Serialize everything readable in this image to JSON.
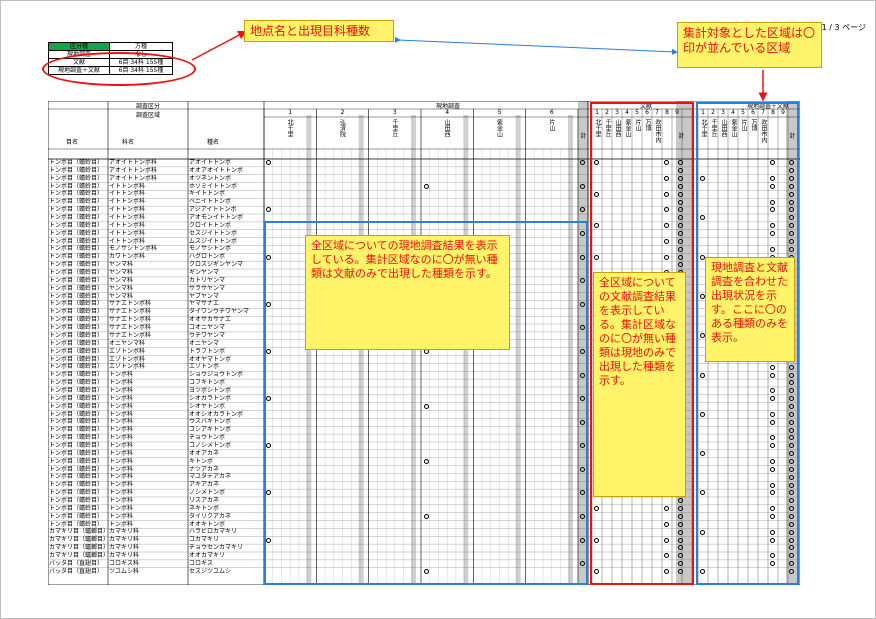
{
  "page": {
    "number": "1 / 3 ページ"
  },
  "summary": {
    "header": [
      "区分種",
      "方種"
    ],
    "rows": [
      [
        "現地調査",
        "なし"
      ],
      [
        "文献",
        "6目 34科 155種"
      ],
      [
        "現地調査＋文献",
        "6目 34科 155種"
      ]
    ]
  },
  "callouts": {
    "site_names": "地点名と出現目科種数",
    "target_areas": "集計対象とした区域は〇印が並んでいる区域",
    "field_all": "全区域についての現地調査結果を表示している。集計区域なのに〇が無い種類は文献のみで出現した種類を示す。",
    "lit_all": "全区域についての文献調査結果を表示している。集計区域なのに〇が無い種類は現地のみで出現した種類を示す。",
    "combined": "現地調査と文献調査を合わせた出現状況を示す。ここに〇のある種類のみを表示。"
  },
  "table": {
    "header": {
      "section": "調査区分",
      "area": "調査区域",
      "order": "目名",
      "family": "科名",
      "species": "種名",
      "field": "現地調査",
      "literature": "文献",
      "combined": "現地調査＋文献",
      "total": "計",
      "site_numbers": [
        "1",
        "2",
        "3",
        "4",
        "5",
        "6"
      ],
      "site_names": [
        "北千里",
        "弘済院",
        "千里丘",
        "山田西",
        "紫金山",
        "片山"
      ],
      "lit_numbers": [
        "1",
        "2",
        "3",
        "4",
        "5",
        "6",
        "7",
        "8",
        "9"
      ],
      "lit_names": [
        "北千里",
        "千里丘",
        "山田西",
        "紫金山",
        "片山",
        "万博",
        "吹田市内"
      ]
    },
    "rows": [
      [
        "トンボ目（蜻蛉目）",
        "アオイトトンボ科",
        "アオイトトンボ"
      ],
      [
        "トンボ目（蜻蛉目）",
        "アオイトトンボ科",
        "オオアオイトトンボ"
      ],
      [
        "トンボ目（蜻蛉目）",
        "アオイトトンボ科",
        "オツネントンボ"
      ],
      [
        "トンボ目（蜻蛉目）",
        "イトトンボ科",
        "ホソミイトトンボ"
      ],
      [
        "トンボ目（蜻蛉目）",
        "イトトンボ科",
        "キイトトンボ"
      ],
      [
        "トンボ目（蜻蛉目）",
        "イトトンボ科",
        "ベニイトトンボ"
      ],
      [
        "トンボ目（蜻蛉目）",
        "イトトンボ科",
        "アジアイトトンボ"
      ],
      [
        "トンボ目（蜻蛉目）",
        "イトトンボ科",
        "アオモンイトトンボ"
      ],
      [
        "トンボ目（蜻蛉目）",
        "イトトンボ科",
        "クロイトトンボ"
      ],
      [
        "トンボ目（蜻蛉目）",
        "イトトンボ科",
        "セスジイトトンボ"
      ],
      [
        "トンボ目（蜻蛉目）",
        "イトトンボ科",
        "ムスジイトトンボ"
      ],
      [
        "トンボ目（蜻蛉目）",
        "モノサシトンボ科",
        "モノサシトンボ"
      ],
      [
        "トンボ目（蜻蛉目）",
        "カワトンボ科",
        "ハグロトンボ"
      ],
      [
        "トンボ目（蜻蛉目）",
        "ヤンマ科",
        "クロスジギンヤンマ"
      ],
      [
        "トンボ目（蜻蛉目）",
        "ヤンマ科",
        "ギンヤンマ"
      ],
      [
        "トンボ目（蜻蛉目）",
        "ヤンマ科",
        "カトリヤンマ"
      ],
      [
        "トンボ目（蜻蛉目）",
        "ヤンマ科",
        "サラサヤンマ"
      ],
      [
        "トンボ目（蜻蛉目）",
        "ヤンマ科",
        "ヤブヤンマ"
      ],
      [
        "トンボ目（蜻蛉目）",
        "サナエトンボ科",
        "ヤマサナエ"
      ],
      [
        "トンボ目（蜻蛉目）",
        "サナエトンボ科",
        "タイワンウチワヤンマ"
      ],
      [
        "トンボ目（蜻蛉目）",
        "サナエトンボ科",
        "オオサカサナエ"
      ],
      [
        "トンボ目（蜻蛉目）",
        "サナエトンボ科",
        "コオニヤンマ"
      ],
      [
        "トンボ目（蜻蛉目）",
        "サナエトンボ科",
        "ウチワヤンマ"
      ],
      [
        "トンボ目（蜻蛉目）",
        "オニヤンマ科",
        "オニヤンマ"
      ],
      [
        "トンボ目（蜻蛉目）",
        "エゾトンボ科",
        "トラフトンボ"
      ],
      [
        "トンボ目（蜻蛉目）",
        "エゾトンボ科",
        "オオヤマトンボ"
      ],
      [
        "トンボ目（蜻蛉目）",
        "エゾトンボ科",
        "エゾトンボ"
      ],
      [
        "トンボ目（蜻蛉目）",
        "トンボ科",
        "ショウジョウトンボ"
      ],
      [
        "トンボ目（蜻蛉目）",
        "トンボ科",
        "コフキトンボ"
      ],
      [
        "トンボ目（蜻蛉目）",
        "トンボ科",
        "ヨツボシトンボ"
      ],
      [
        "トンボ目（蜻蛉目）",
        "トンボ科",
        "シオカラトンボ"
      ],
      [
        "トンボ目（蜻蛉目）",
        "トンボ科",
        "シオヤトンボ"
      ],
      [
        "トンボ目（蜻蛉目）",
        "トンボ科",
        "オオシオカラトンボ"
      ],
      [
        "トンボ目（蜻蛉目）",
        "トンボ科",
        "ウスバキトンボ"
      ],
      [
        "トンボ目（蜻蛉目）",
        "トンボ科",
        "コシアキトンボ"
      ],
      [
        "トンボ目（蜻蛉目）",
        "トンボ科",
        "チョウトンボ"
      ],
      [
        "トンボ目（蜻蛉目）",
        "トンボ科",
        "コノシメトンボ"
      ],
      [
        "トンボ目（蜻蛉目）",
        "トンボ科",
        "オオアカネ"
      ],
      [
        "トンボ目（蜻蛉目）",
        "トンボ科",
        "キトンボ"
      ],
      [
        "トンボ目（蜻蛉目）",
        "トンボ科",
        "ナツアカネ"
      ],
      [
        "トンボ目（蜻蛉目）",
        "トンボ科",
        "マユタテアカネ"
      ],
      [
        "トンボ目（蜻蛉目）",
        "トンボ科",
        "アキアカネ"
      ],
      [
        "トンボ目（蜻蛉目）",
        "トンボ科",
        "ノシメトンボ"
      ],
      [
        "トンボ目（蜻蛉目）",
        "トンボ科",
        "リスアカネ"
      ],
      [
        "トンボ目（蜻蛉目）",
        "トンボ科",
        "ネキトンボ"
      ],
      [
        "トンボ目（蜻蛉目）",
        "トンボ科",
        "タイリクアカネ"
      ],
      [
        "トンボ目（蜻蛉目）",
        "トンボ科",
        "オオキトンボ"
      ],
      [
        "カマキリ目（蟷螂目）",
        "カマキリ科",
        "ハラビロカマキリ"
      ],
      [
        "カマキリ目（蟷螂目）",
        "カマキリ科",
        "コカマキリ"
      ],
      [
        "カマキリ目（蟷螂目）",
        "カマキリ科",
        "チョウセンカマキリ"
      ],
      [
        "カマキリ目（蟷螂目）",
        "カマキリ科",
        "オオカマキリ"
      ],
      [
        "バッタ目（直翅目）",
        "コロギス科",
        "コロギス"
      ],
      [
        "バッタ目（直翅目）",
        "ツユムシ科",
        "セスジツユムシ"
      ]
    ]
  }
}
